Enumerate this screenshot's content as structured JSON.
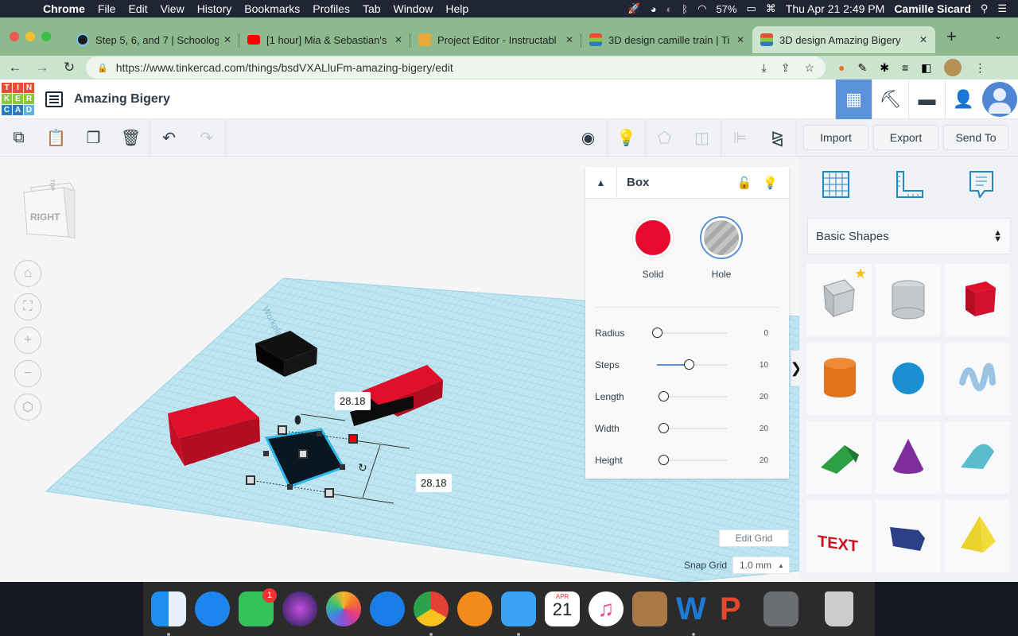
{
  "menubar": {
    "app": "Chrome",
    "items": [
      "File",
      "Edit",
      "View",
      "History",
      "Bookmarks",
      "Profiles",
      "Tab",
      "Window",
      "Help"
    ],
    "battery": "57%",
    "datetime": "Thu Apr 21  2:49 PM",
    "user": "Camille Sicard"
  },
  "browser": {
    "tabs": [
      {
        "title": "Step 5, 6, and 7 | Schoolog",
        "icon": "schoology-icon"
      },
      {
        "title": "[1 hour] Mia & Sebastian's",
        "icon": "youtube-icon"
      },
      {
        "title": "Project Editor - Instructabl",
        "icon": "instructables-icon"
      },
      {
        "title": "3D design camille train | Ti",
        "icon": "tinkercad-icon"
      },
      {
        "title": "3D design Amazing Bigery",
        "icon": "tinkercad-icon",
        "active": true
      }
    ],
    "url": "https://www.tinkercad.com/things/bsdVXALluFm-amazing-bigery/edit"
  },
  "app": {
    "logo": [
      "T",
      "I",
      "N",
      "K",
      "E",
      "R",
      "C",
      "A",
      "D"
    ],
    "logo_colors": [
      "#e84e33",
      "#e84e33",
      "#e84e33",
      "#8dc63f",
      "#8dc63f",
      "#8dc63f",
      "#2c7bbf",
      "#2c7bbf",
      "#62b0e0"
    ],
    "project_title": "Amazing Bigery",
    "toolbar_buttons": {
      "import": "Import",
      "export": "Export",
      "send_to": "Send To"
    }
  },
  "viewcube": {
    "face_label": "RIGHT",
    "top_label": "TOP"
  },
  "viewport": {
    "workplane_label": "Workplane",
    "dimension_labels": [
      "28.18",
      "28.18"
    ]
  },
  "inspector": {
    "shape_name": "Box",
    "solid_label": "Solid",
    "hole_label": "Hole",
    "solid_color": "#e8092e",
    "selected_mode": "Hole",
    "properties": [
      {
        "label": "Radius",
        "value": "0",
        "fraction": 0.0
      },
      {
        "label": "Steps",
        "value": "10",
        "fraction": 0.45
      },
      {
        "label": "Length",
        "value": "20",
        "fraction": 0.09
      },
      {
        "label": "Width",
        "value": "20",
        "fraction": 0.09
      },
      {
        "label": "Height",
        "value": "20",
        "fraction": 0.09
      }
    ]
  },
  "grid": {
    "edit_label": "Edit Grid",
    "snap_label": "Snap Grid",
    "snap_value": "1.0 mm"
  },
  "library": {
    "selected": "Basic Shapes",
    "shapes": [
      {
        "name": "Box Hole",
        "color": "#b9bec4"
      },
      {
        "name": "Cylinder Hole",
        "color": "#b9bec4"
      },
      {
        "name": "Box",
        "color": "#d1112d"
      },
      {
        "name": "Cylinder",
        "color": "#e0731c"
      },
      {
        "name": "Sphere",
        "color": "#1b8fcf"
      },
      {
        "name": "Scribble",
        "color": "#9dc3e3"
      },
      {
        "name": "Roof",
        "color": "#2ea043"
      },
      {
        "name": "Cone",
        "color": "#7e2d9c"
      },
      {
        "name": "Round Roof",
        "color": "#5bbccc"
      },
      {
        "name": "Text",
        "color": "#c9141f"
      },
      {
        "name": "Polygon",
        "color": "#2c3f87"
      },
      {
        "name": "Pyramid",
        "color": "#ead22c"
      }
    ]
  },
  "dock": {
    "apps": [
      "Finder",
      "App Store",
      "FaceTime",
      "Siri",
      "Photos",
      "Safari",
      "Chrome",
      "Books",
      "Messages",
      "Calendar",
      "Music",
      "Contacts",
      "Word",
      "PowerPoint",
      "System Preferences",
      "Trash"
    ],
    "facetime_badge": "1",
    "calendar_month": "APR",
    "calendar_day": "21"
  }
}
